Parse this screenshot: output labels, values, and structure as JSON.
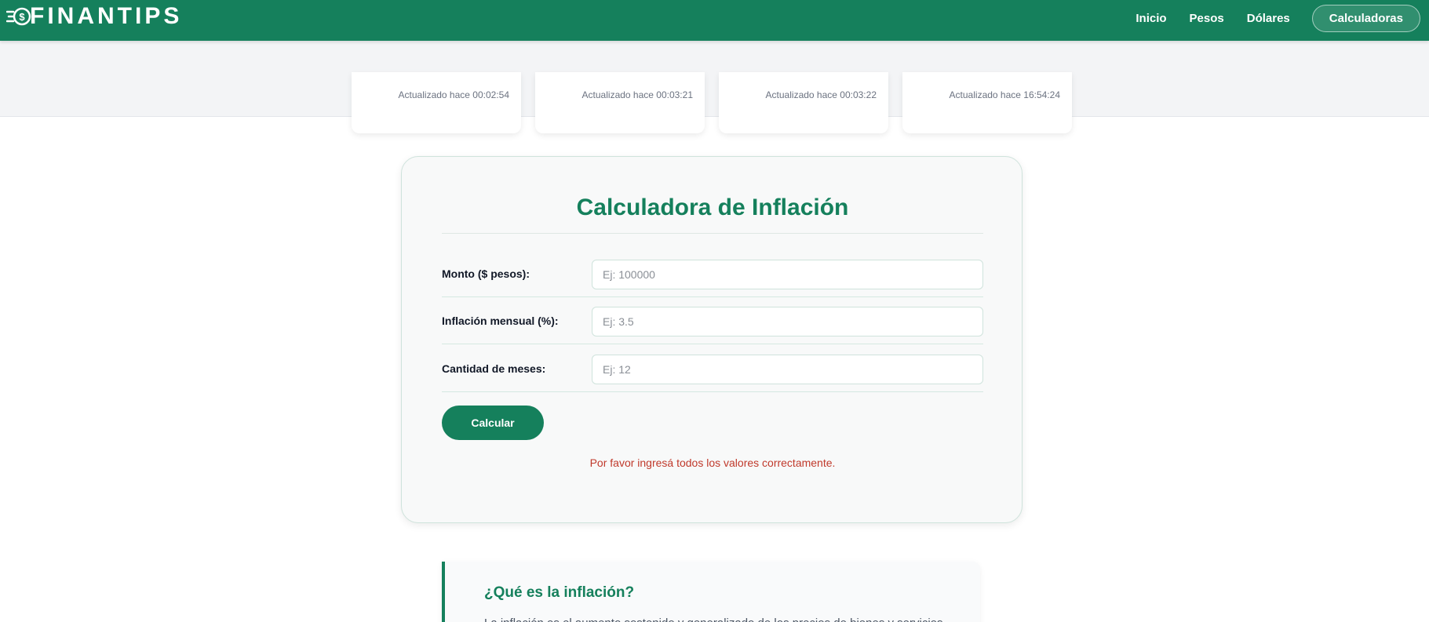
{
  "brand": {
    "logo_text": "FINANTIPS",
    "logo_icon": "dollar-coin-icon",
    "primary_color": "#15805c"
  },
  "nav": {
    "links": [
      {
        "label": "Inicio"
      },
      {
        "label": "Pesos"
      },
      {
        "label": "Dólares"
      }
    ],
    "active_label": "Calculadoras"
  },
  "ticker": {
    "cards": [
      {
        "updated": "Actualizado hace 00:02:54"
      },
      {
        "updated": "Actualizado hace 00:03:21"
      },
      {
        "updated": "Actualizado hace 00:03:22"
      },
      {
        "updated": "Actualizado hace 16:54:24"
      }
    ]
  },
  "calculator": {
    "title": "Calculadora de Inflación",
    "fields": [
      {
        "label": "Monto ($ pesos):",
        "value": "",
        "placeholder": "Ej: 100000"
      },
      {
        "label": "Inflación mensual (%):",
        "value": "",
        "placeholder": "Ej: 3.5"
      },
      {
        "label": "Cantidad de meses:",
        "value": "",
        "placeholder": "Ej: 12"
      }
    ],
    "button_label": "Calcular",
    "error_message": "Por favor ingresá todos los valores correctamente.",
    "error_color": "#c0392b"
  },
  "info": {
    "title": "¿Qué es la inflación?",
    "text": "La inflación es el aumento sostenido y generalizado de los precios de bienes y servicios en"
  }
}
